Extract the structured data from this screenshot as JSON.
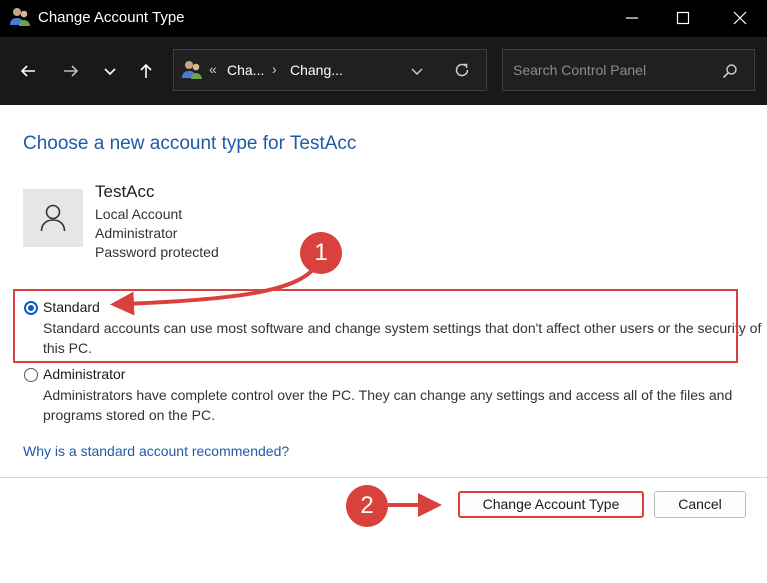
{
  "window": {
    "title": "Change Account Type",
    "icon": "user-accounts-icon"
  },
  "nav": {
    "breadcrumb_prefix": "«",
    "breadcrumbs": [
      "Cha...",
      "Chang..."
    ],
    "search_placeholder": "Search Control Panel"
  },
  "content": {
    "heading": "Choose a new account type for TestAcc",
    "account": {
      "name": "TestAcc",
      "type": "Local Account",
      "role": "Administrator",
      "security": "Password protected"
    },
    "options": [
      {
        "label": "Standard",
        "description": "Standard accounts can use most software and change system settings that don't affect other users or the security of this PC.",
        "selected": true
      },
      {
        "label": "Administrator",
        "description": "Administrators have complete control over the PC. They can change any settings and access all of the files and programs stored on the PC.",
        "selected": false
      }
    ],
    "help_link": "Why is a standard account recommended?"
  },
  "footer": {
    "primary_button": "Change Account Type",
    "cancel_button": "Cancel"
  },
  "annotations": {
    "step1": "1",
    "step2": "2",
    "color": "#d9413c"
  }
}
